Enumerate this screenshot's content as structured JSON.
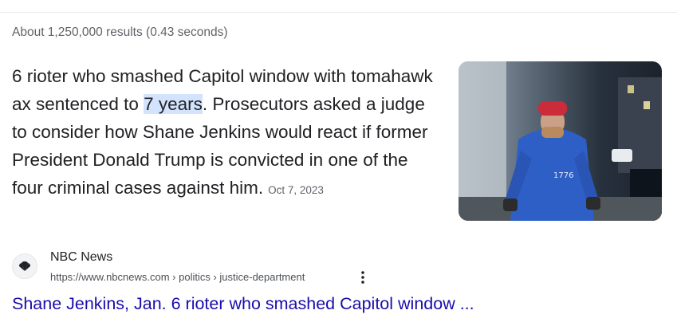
{
  "search": {
    "result_stats": "About 1,250,000 results (0.43 seconds)"
  },
  "featured": {
    "snippet_before": "6 rioter who smashed Capitol window with tomahawk ax sentenced to ",
    "snippet_highlight": "7 years",
    "snippet_after": ". Prosecutors asked a judge to consider how Shane Jenkins would react if former President Donald Trump is convicted in one of the four criminal cases against him.",
    "date": "Oct 7, 2023",
    "image_caption": "1776"
  },
  "source": {
    "site_name": "NBC News",
    "url": "https://www.nbcnews.com › politics › justice-department",
    "favicon": "nbc-peacock-icon",
    "menu_icon": "more-vert-icon"
  },
  "result": {
    "title": "Shane Jenkins, Jan. 6 rioter who smashed Capitol window ..."
  },
  "colors": {
    "link": "#1a0dab",
    "highlight": "#d3e3fd",
    "meta": "#5f6368"
  }
}
